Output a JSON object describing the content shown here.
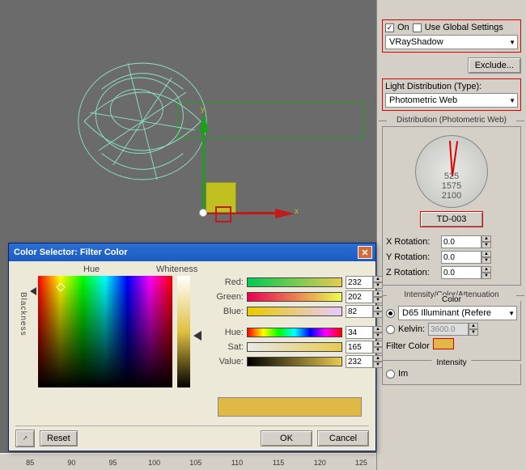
{
  "viewport": {
    "x_label": "x",
    "y_label": "y"
  },
  "ruler": {
    "ticks": [
      85,
      90,
      95,
      100,
      105,
      110,
      115,
      120,
      125
    ]
  },
  "side": {
    "on_label": "On",
    "on_checked": "✓",
    "global_label": "Use Global Settings",
    "shadow_type": "VRayShadow",
    "exclude_btn": "Exclude...",
    "dist_label": "Light Distribution (Type):",
    "dist_value": "Photometric Web",
    "dist_group": "Distribution (Photometric Web)",
    "web_nums": [
      "525",
      "1575",
      "2100"
    ],
    "web_file": "TD-003",
    "xrot_label": "X Rotation:",
    "xrot_val": "0.0",
    "yrot_label": "Y Rotation:",
    "yrot_val": "0.0",
    "zrot_label": "Z Rotation:",
    "zrot_val": "0.0",
    "ica_title": "Intensity/Color/Attenuation",
    "color_group": "Color",
    "d65_label": "D65 Illuminant (Refere",
    "kelvin_label": "Kelvin:",
    "kelvin_val": "3600.0",
    "filter_label": "Filter Color",
    "intensity_group": "Intensity",
    "im_label": "Im"
  },
  "dialog": {
    "title": "Color Selector: Filter Color",
    "hue_label": "Hue",
    "whiteness_label": "Whiteness",
    "blackness_label": "Blackness",
    "channels": {
      "red": {
        "label": "Red:",
        "value": "232"
      },
      "green": {
        "label": "Green:",
        "value": "202"
      },
      "blue": {
        "label": "Blue:",
        "value": "82"
      },
      "hue": {
        "label": "Hue:",
        "value": "34"
      },
      "sat": {
        "label": "Sat:",
        "value": "165"
      },
      "val": {
        "label": "Value:",
        "value": "232"
      }
    },
    "reset": "Reset",
    "ok": "OK",
    "cancel": "Cancel"
  },
  "colors": {
    "cur": "#e0b846",
    "grads": {
      "red": "linear-gradient(to right,#00ca52,#e8ca52)",
      "green": "linear-gradient(to right,#e80052,#e8ff52)",
      "blue": "linear-gradient(to right,#e8ca00,#e8caff)",
      "hue": "linear-gradient(to right,red,yellow,lime,cyan,blue,magenta,red)",
      "sat": "linear-gradient(to right,#e8e8e8,#e8ca52)",
      "val": "linear-gradient(to right,#000,#e8ca52)"
    }
  }
}
